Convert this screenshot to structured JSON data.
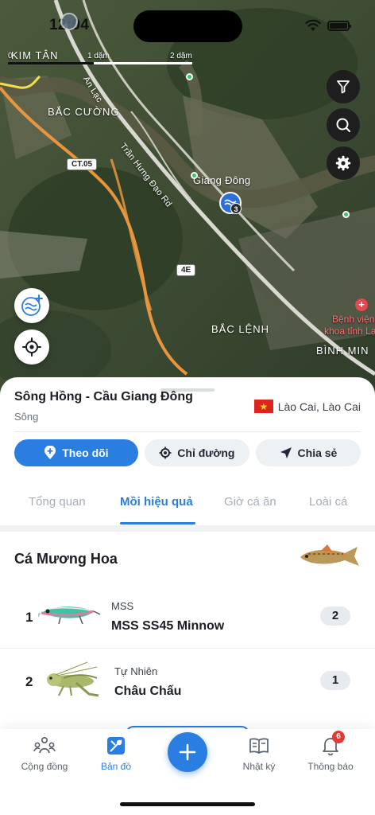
{
  "status_bar": {
    "time": "12:04"
  },
  "map": {
    "scale": {
      "labels": [
        "0",
        "1 dặm",
        "2 dặm"
      ]
    },
    "labels": {
      "kim_tan": "KIM TÂN",
      "an_lac": "An Lạc",
      "bac_cuong": "BẮC CƯỜNG",
      "tran_hung_dao": "Trần Hưng Đạo Rd",
      "giang_dong": "Giang Đông",
      "bac_lenh": "BẮC LỆNH",
      "binh_minh": "BÌNH MIN",
      "hospital_line1": "Bệnh viện",
      "hospital_line2": "khoa tỉnh Lạ"
    },
    "road_badges": {
      "ct05": "CT.05",
      "r4e": "4E"
    },
    "marker_count": "3",
    "icons": {
      "filter": "filter-icon",
      "search": "search-icon",
      "settings": "gear-icon",
      "water_add": "water-add-icon",
      "locate": "locate-icon"
    }
  },
  "place": {
    "title": "Sông Hồng - Cầu Giang Đông",
    "type": "Sông",
    "region": "Lào Cai, Lào Cai"
  },
  "actions": {
    "follow": "Theo dõi",
    "directions": "Chỉ đường",
    "share": "Chia sẻ"
  },
  "tabs": [
    {
      "label": "Tổng quan",
      "active": false
    },
    {
      "label": "Mồi hiệu quả",
      "active": true
    },
    {
      "label": "Giờ cá ăn",
      "active": false
    },
    {
      "label": "Loài cá",
      "active": false
    }
  ],
  "fish": {
    "name": "Cá Mương Hoa"
  },
  "baits": [
    {
      "rank": "1",
      "brand": "MSS",
      "name": "MSS SS45 Minnow",
      "count": "2"
    },
    {
      "rank": "2",
      "brand": "Tự Nhiên",
      "name": "Châu Chấu",
      "count": "1"
    }
  ],
  "nav": {
    "community": "Cộng đồng",
    "map": "Bản đồ",
    "journal": "Nhật ký",
    "notifications": "Thông báo",
    "notifications_badge": "6"
  },
  "colors": {
    "accent": "#2a7de1",
    "badge": "#e53935"
  }
}
